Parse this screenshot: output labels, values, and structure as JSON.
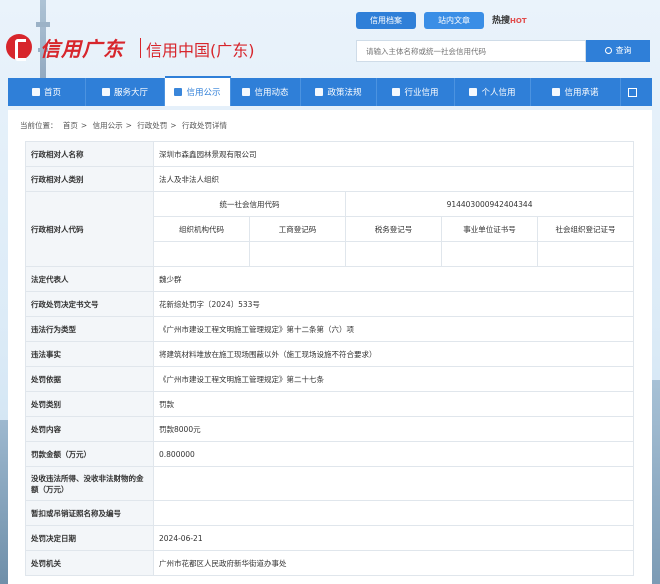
{
  "header": {
    "logo_script": "信用广东",
    "logo_title": "信用中国(广东)",
    "tab_archive": "信用档案",
    "tab_search": "站内文章",
    "hot": "热搜",
    "hot_badge": "HOT",
    "search_placeholder": "请输入主体名称或统一社会信用代码",
    "search_button": "查询"
  },
  "nav": {
    "items": [
      {
        "label": "首页",
        "icon": "home-icon"
      },
      {
        "label": "服务大厅",
        "icon": "grid-icon"
      },
      {
        "label": "信用公示",
        "icon": "document-icon"
      },
      {
        "label": "信用动态",
        "icon": "news-icon"
      },
      {
        "label": "政策法规",
        "icon": "book-icon"
      },
      {
        "label": "行业信用",
        "icon": "building-icon"
      },
      {
        "label": "个人信用",
        "icon": "user-icon"
      },
      {
        "label": "信用承诺",
        "icon": "shield-icon"
      }
    ]
  },
  "breadcrumb": {
    "prefix": "当前位置：",
    "items": [
      "首页",
      "信用公示",
      "行政处罚",
      "行政处罚详情"
    ],
    "sep": ">"
  },
  "detail": {
    "name_label": "行政相对人名称",
    "name_value": "深圳市森鑫园林景观有限公司",
    "type_label": "行政相对人类别",
    "type_value": "法人及非法人组织",
    "code_label": "行政相对人代码",
    "uscc_label": "统一社会信用代码",
    "uscc_value": "914403000942404344",
    "org_code_label": "组织机构代码",
    "biz_reg_label": "工商登记码",
    "tax_reg_label": "税务登记号",
    "inst_cert_label": "事业单位证书号",
    "social_org_label": "社会组织登记证号",
    "org_code_value": "",
    "biz_reg_value": "",
    "tax_reg_value": "",
    "inst_cert_value": "",
    "social_org_value": "",
    "rep_label": "法定代表人",
    "rep_value": "魏少群",
    "doc_no_label": "行政处罚决定书文号",
    "doc_no_value": "花新综处罚字〔2024〕533号",
    "violation_type_label": "违法行为类型",
    "violation_type_value": "《广州市建设工程文明施工管理规定》第十二条第（六）项",
    "violation_fact_label": "违法事实",
    "violation_fact_value": "将建筑材料堆放在施工现场围蔽以外（施工现场设施不符合要求）",
    "basis_label": "处罚依据",
    "basis_value": "《广州市建设工程文明施工管理规定》第二十七条",
    "category_label": "处罚类别",
    "category_value": "罚款",
    "content_label": "处罚内容",
    "content_value": "罚款8000元",
    "amount_label": "罚款金额（万元）",
    "amount_value": "0.800000",
    "confiscate_label": "没收违法所得、没收非法财物的金额（万元）",
    "confiscate_value": "",
    "revoke_label": "暂扣或吊销证照名称及编号",
    "revoke_value": "",
    "date_label": "处罚决定日期",
    "date_value": "2024-06-21",
    "authority_label": "处罚机关",
    "authority_value": "广州市花都区人民政府新华街道办事处"
  },
  "colors": {
    "brand_red": "#d7262c",
    "primary_blue": "#2f7fd8",
    "label_bg": "#f3f6f9"
  }
}
